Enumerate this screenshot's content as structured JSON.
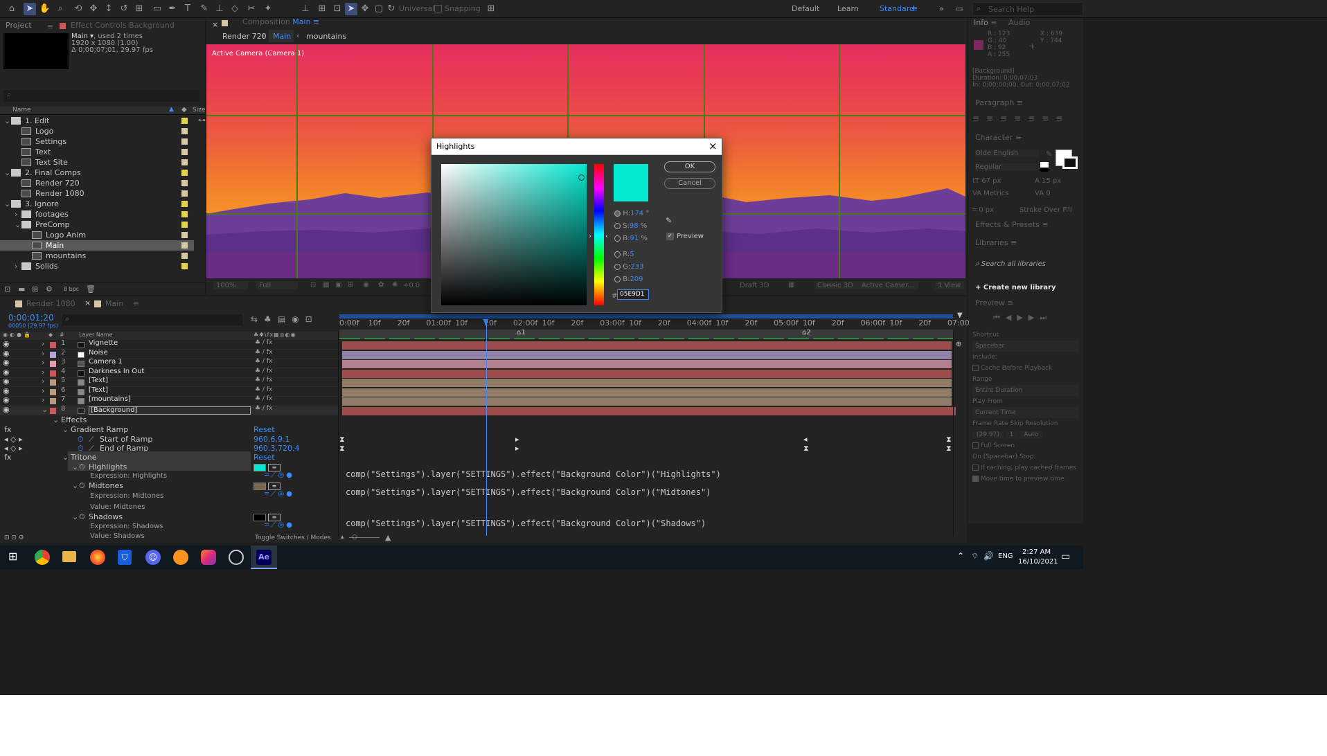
{
  "toolbar": {
    "snapping": "Snapping",
    "universal": "Universal",
    "workspaces": [
      "Default",
      "Learn",
      "Standard"
    ],
    "search_placeholder": "Search Help"
  },
  "project": {
    "tab_project": "Project",
    "tab_effect": "Effect Controls Background",
    "item_name": "Main",
    "item_used": ", used 2 times",
    "item_size": "1920 x 1080 (1.00)",
    "item_duration": "Δ 0;00;07;01, 29.97 fps",
    "col_name": "Name",
    "col_size": "Size",
    "bpc": "8 bpc",
    "tree": [
      {
        "label": "1. Edit",
        "type": "folder",
        "indent": 0,
        "expanded": true,
        "color": "#e3d24f"
      },
      {
        "label": "Logo",
        "type": "comp",
        "indent": 1,
        "color": "#d6c7a4"
      },
      {
        "label": "Settings",
        "type": "comp",
        "indent": 1,
        "color": "#d6c7a4"
      },
      {
        "label": "Text",
        "type": "comp",
        "indent": 1,
        "color": "#d6c7a4"
      },
      {
        "label": "Text Site",
        "type": "comp",
        "indent": 1,
        "color": "#d6c7a4"
      },
      {
        "label": "2. Final Comps",
        "type": "folder",
        "indent": 0,
        "expanded": true,
        "color": "#e3d24f"
      },
      {
        "label": "Render 720",
        "type": "comp",
        "indent": 1,
        "color": "#d6c7a4"
      },
      {
        "label": "Render 1080",
        "type": "comp",
        "indent": 1,
        "color": "#d6c7a4"
      },
      {
        "label": "3. Ignore",
        "type": "folder",
        "indent": 0,
        "expanded": true,
        "color": "#e3d24f"
      },
      {
        "label": "footages",
        "type": "folder",
        "indent": 1,
        "expanded": false,
        "color": "#e3d24f"
      },
      {
        "label": "PreComp",
        "type": "folder",
        "indent": 1,
        "expanded": true,
        "color": "#e3d24f"
      },
      {
        "label": "Logo Anim",
        "type": "comp",
        "indent": 2,
        "color": "#d6c7a4"
      },
      {
        "label": "Main",
        "type": "comp",
        "indent": 2,
        "color": "#d6c7a4",
        "selected": true
      },
      {
        "label": "mountains",
        "type": "comp",
        "indent": 2,
        "color": "#d6c7a4"
      },
      {
        "label": "Solids",
        "type": "folder",
        "indent": 1,
        "expanded": false,
        "color": "#e3d24f"
      }
    ]
  },
  "composition": {
    "tab": "Composition",
    "tab_active": "Main",
    "breadcrumb": [
      "Render 720",
      "Main",
      "mountains"
    ],
    "camera_label": "Active Camera (Camera 1)",
    "zoom": "100%",
    "resolution": "Full",
    "exposure": "+0.0",
    "renderer": "Draft 3D",
    "classic": "Classic 3D",
    "view": "Active Camer...",
    "views": "1 View"
  },
  "dialog": {
    "title": "Highlights",
    "ok": "OK",
    "cancel": "Cancel",
    "preview": "Preview",
    "color": "#05E9D1",
    "h_label": "H:",
    "h_value": "174",
    "h_unit": "°",
    "s_label": "S:",
    "s_value": "98",
    "s_unit": "%",
    "b_label": "B:",
    "b_value": "91",
    "b_unit": "%",
    "r_label": "R:",
    "r_value": "5",
    "g_label": "G:",
    "g_value": "233",
    "b2_label": "B:",
    "b2_value": "209",
    "hex_prefix": "#",
    "hex_value": "05E9D1"
  },
  "info": {
    "tab_info": "Info",
    "tab_audio": "Audio",
    "r": "R : 123",
    "g": "G : 40",
    "b": "B : 92",
    "a": "A : 255",
    "x": "X : 639",
    "y": "Y : 744",
    "layer": "[Background]",
    "duration": "Duration: 0;00;07;03",
    "inout": "In: 0;00;00;00, Out: 0;00;07;02"
  },
  "paragraph": {
    "title": "Paragraph"
  },
  "character": {
    "title": "Character",
    "font": "Olde English",
    "style": "Regular",
    "size": "67 px",
    "leading": "15 px",
    "kerning": "Metrics",
    "tracking": "0",
    "stroke": "0 px",
    "stroke_type": "Stroke Over Fill"
  },
  "effects_presets": {
    "title": "Effects & Presets"
  },
  "libraries": {
    "title": "Libraries",
    "search": "Search all libraries",
    "create": "Create new library"
  },
  "preview": {
    "title": "Preview",
    "shortcut_label": "Shortcut",
    "shortcut": "Spacebar",
    "include": "Include:",
    "cache": "Cache Before Playback",
    "range_label": "Range",
    "range": "Entire Duration",
    "playfrom_label": "Play From",
    "playfrom": "Current Time",
    "framerate_label": "Frame Rate",
    "skip_label": "Skip",
    "resolution_label": "Resolution",
    "framerate": "(29.97)",
    "skip": "1",
    "resolution": "Auto",
    "fullscreen": "Full Screen",
    "stop_label": "On (Spacebar) Stop:",
    "ifcaching": "If caching, play cached frames",
    "movetime": "Move time to preview time"
  },
  "timeline": {
    "tab1": "Render 1080",
    "tab2": "Main",
    "timecode": "0;00;01;20",
    "fps_line": "00050 (29.97 fps)",
    "col_layer": "Layer Name",
    "toggle": "Toggle Switches / Modes",
    "ticks": [
      "0:00f",
      "10f",
      "20f",
      "01:00f",
      "10f",
      "20f",
      "02:00f",
      "10f",
      "20f",
      "03:00f",
      "10f",
      "20f",
      "04:00f",
      "10f",
      "20f",
      "05:00f",
      "10f",
      "20f",
      "06:00f",
      "10f",
      "20f",
      "07:00"
    ],
    "layers": [
      {
        "num": "1",
        "name": "Vignette",
        "color": "#c75b5b",
        "box": "#111",
        "label": "#c75b5b"
      },
      {
        "num": "2",
        "name": "Noise",
        "color": "#b8a3d6",
        "box": "#fff",
        "label": "#b8a3d6"
      },
      {
        "num": "3",
        "name": "Camera 1",
        "color": "#e0a0b0",
        "box": "#555",
        "label": "#e0a0b0"
      },
      {
        "num": "4",
        "name": "Darkness In Out",
        "color": "#c75b5b",
        "box": "#111",
        "label": "#c75b5b"
      },
      {
        "num": "5",
        "name": "[Text]",
        "color": "#b59b80",
        "box": "#888",
        "label": "#b59b80"
      },
      {
        "num": "6",
        "name": "[Text]",
        "color": "#b59b80",
        "box": "#888",
        "label": "#b59b80"
      },
      {
        "num": "7",
        "name": "[mountains]",
        "color": "#b59b80",
        "box": "#888",
        "label": "#b59b80"
      },
      {
        "num": "8",
        "name": "[Background]",
        "color": "#c75b5b",
        "box": "#222",
        "label": "#c75b5b"
      }
    ],
    "props": {
      "effects": "Effects",
      "gradient": "Gradient Ramp",
      "reset": "Reset",
      "start": "Start of Ramp",
      "start_val": "960.6,9.1",
      "end": "End of Ramp",
      "end_val": "960.3,720.4",
      "tritone": "Tritone",
      "highlights": "Highlights",
      "expr_high": "Expression: Highlights",
      "midtones": "Midtones",
      "expr_mid": "Expression: Midtones",
      "value_mid": "Value: Midtones",
      "shadows": "Shadows",
      "expr_shadow": "Expression: Shadows",
      "value_shadow": "Value: Shadows"
    },
    "expressions": [
      "comp(\"Settings\").layer(\"SETTINGS\").effect(\"Background Color\")(\"Highlights\")",
      "comp(\"Settings\").layer(\"SETTINGS\").effect(\"Background Color\")(\"Midtones\")",
      "comp(\"Settings\").layer(\"SETTINGS\").effect(\"Background Color\")(\"Shadows\")"
    ]
  },
  "taskbar": {
    "lang": "ENG",
    "time": "2:27 AM",
    "date": "16/10/2021"
  }
}
